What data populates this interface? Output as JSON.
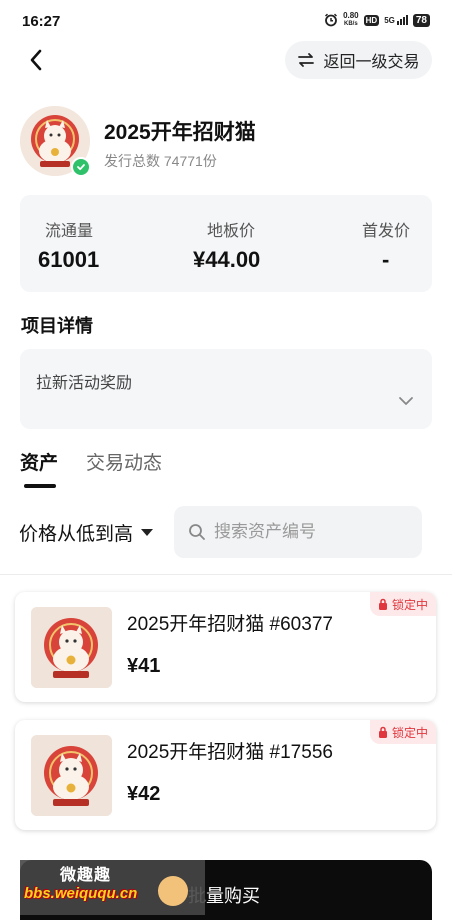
{
  "status_bar": {
    "time": "16:27",
    "net_speed_value": "0.80",
    "net_speed_unit": "KB/s",
    "hd_badge": "HD",
    "signal_label": "5G",
    "battery": "78"
  },
  "header": {
    "return_label": "返回一级交易"
  },
  "collection": {
    "title": "2025开年招财猫",
    "issue_total": "发行总数 74771份"
  },
  "stats": {
    "circulation_label": "流通量",
    "circulation_value": "61001",
    "floor_label": "地板价",
    "floor_value": "¥44.00",
    "first_price_label": "首发价",
    "first_price_value": "-"
  },
  "details": {
    "section_title": "项目详情",
    "text": "拉新活动奖励"
  },
  "tabs": [
    {
      "label": "资产",
      "active": true
    },
    {
      "label": "交易动态",
      "active": false
    }
  ],
  "filter": {
    "sort_label": "价格从低到高",
    "search_placeholder": "搜索资产编号"
  },
  "items": [
    {
      "name": "2025开年招财猫 #60377",
      "price": "¥41",
      "badge": "锁定中"
    },
    {
      "name": "2025开年招财猫 #17556",
      "price": "¥42",
      "badge": "锁定中"
    }
  ],
  "bottom": {
    "bulk_buy_label": "批量购买"
  },
  "watermark": {
    "line1": "微趣趣",
    "line2": "bbs.weiququ.cn"
  },
  "colors": {
    "accent_dark": "#111111",
    "verified_green": "#2fc26b",
    "lock_red": "#e0363d",
    "card_bg": "#f5f6f8"
  },
  "icons": [
    "back-arrow-icon",
    "swap-arrows-icon",
    "verified-check-icon",
    "chevron-down-icon",
    "sort-caret-icon",
    "search-icon",
    "lock-icon",
    "alarm-icon"
  ]
}
